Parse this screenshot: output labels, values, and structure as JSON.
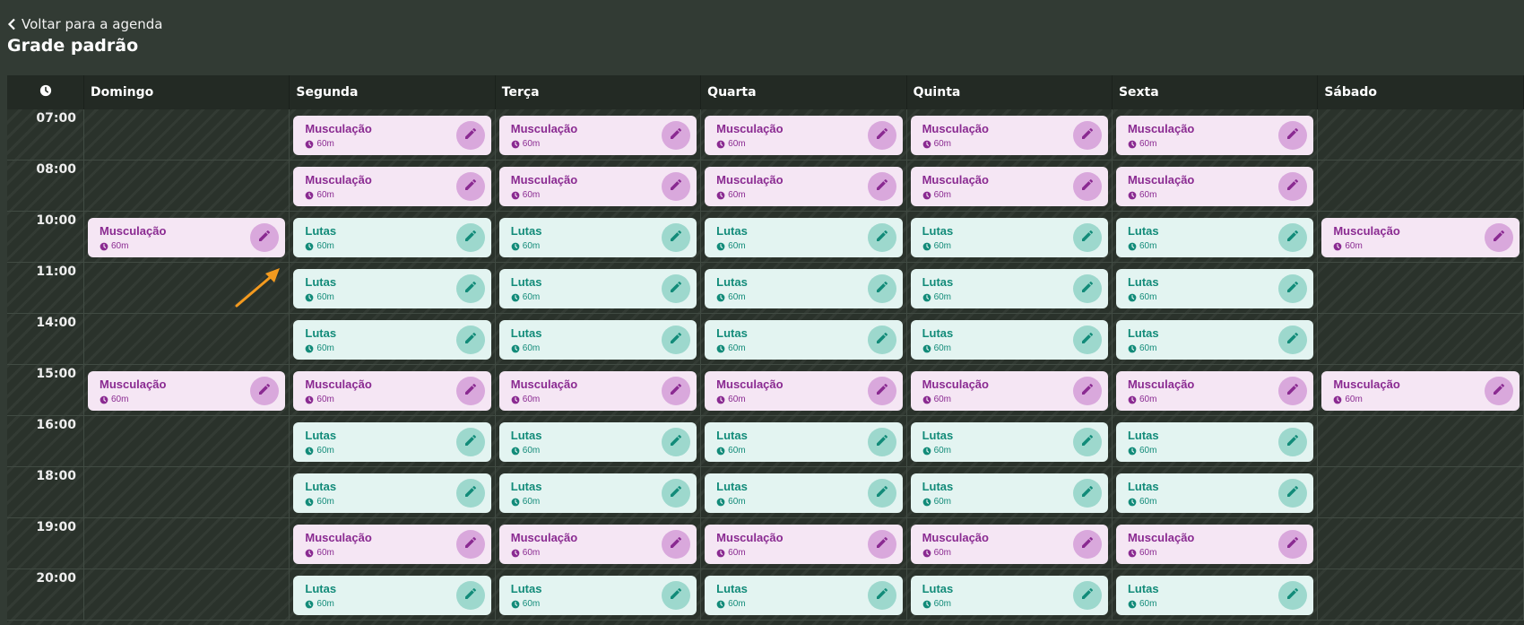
{
  "nav": {
    "back_label": "Voltar para a agenda"
  },
  "page": {
    "title": "Grade padrão"
  },
  "schedule": {
    "days": [
      "Domingo",
      "Segunda",
      "Terça",
      "Quarta",
      "Quinta",
      "Sexta",
      "Sábado"
    ],
    "times": [
      "07:00",
      "08:00",
      "10:00",
      "11:00",
      "14:00",
      "15:00",
      "16:00",
      "18:00",
      "19:00",
      "20:00"
    ],
    "cells": [
      [
        null,
        "M",
        "M",
        "M",
        "M",
        "M",
        null
      ],
      [
        null,
        "M",
        "M",
        "M",
        "M",
        "M",
        null
      ],
      [
        "M",
        "L",
        "L",
        "L",
        "L",
        "L",
        "M"
      ],
      [
        null,
        "L",
        "L",
        "L",
        "L",
        "L",
        null
      ],
      [
        null,
        "L",
        "L",
        "L",
        "L",
        "L",
        null
      ],
      [
        "M",
        "M",
        "M",
        "M",
        "M",
        "M",
        "M"
      ],
      [
        null,
        "L",
        "L",
        "L",
        "L",
        "L",
        null
      ],
      [
        null,
        "L",
        "L",
        "L",
        "L",
        "L",
        null
      ],
      [
        null,
        "M",
        "M",
        "M",
        "M",
        "M",
        null
      ],
      [
        null,
        "L",
        "L",
        "L",
        "L",
        "L",
        null
      ]
    ],
    "class_types": {
      "M": {
        "name": "Musculação",
        "duration": "60m",
        "color": "#8a2a91",
        "bg": "#f5e6f4"
      },
      "L": {
        "name": "Lutas",
        "duration": "60m",
        "color": "#128b79",
        "bg": "#e3f4f1"
      }
    }
  },
  "colors": {
    "background": "#323b34",
    "header_bg": "#232a24",
    "annotation_arrow": "#f39a1f"
  },
  "icons": {
    "back": "chevron-left-icon",
    "time_header": "clock-icon",
    "duration": "clock-icon",
    "edit": "pencil-icon"
  }
}
